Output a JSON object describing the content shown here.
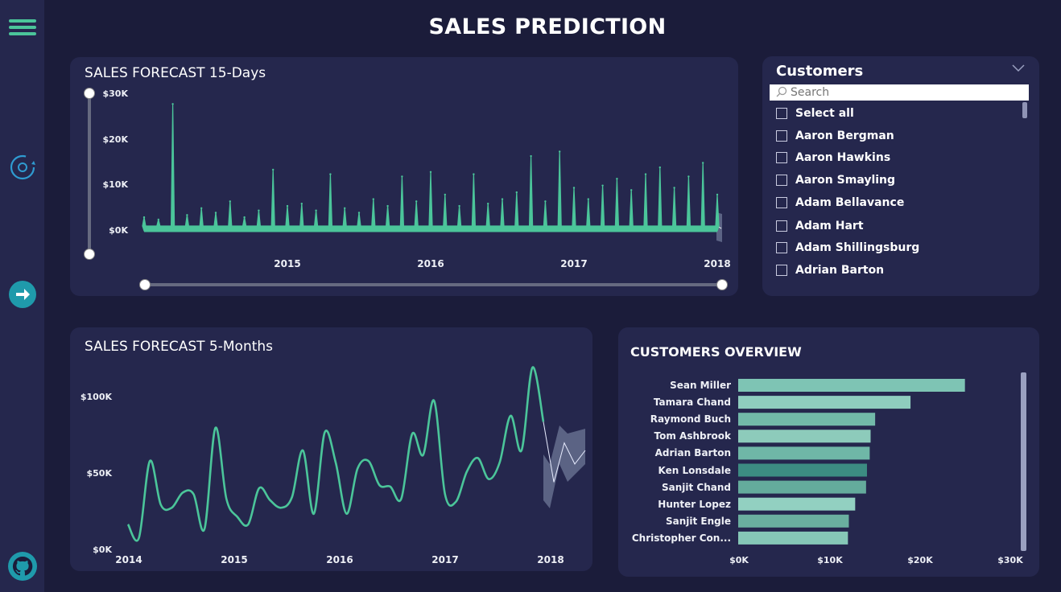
{
  "page_title": "SALES PREDICTION",
  "nav": {
    "icons": [
      "menu-icon",
      "refresh-cycle-icon",
      "arrow-right-icon",
      "github-icon"
    ]
  },
  "forecast_15days": {
    "title": "SALES FORECAST 15-Days",
    "y_ticks": [
      "$30K",
      "$20K",
      "$10K",
      "$0K"
    ],
    "x_ticks": [
      "2015",
      "2016",
      "2017",
      "2018"
    ]
  },
  "forecast_5months": {
    "title": "SALES FORECAST 5-Months",
    "y_ticks": [
      "$100K",
      "$50K",
      "$0K"
    ],
    "x_ticks": [
      "2014",
      "2015",
      "2016",
      "2017",
      "2018"
    ]
  },
  "customers_slicer": {
    "title": "Customers",
    "search_placeholder": "Search",
    "items": [
      "Select all",
      "Aaron Bergman",
      "Aaron Hawkins",
      "Aaron Smayling",
      "Adam Bellavance",
      "Adam Hart",
      "Adam Shillingsburg",
      "Adrian Barton"
    ]
  },
  "customers_overview": {
    "title": "CUSTOMERS OVERVIEW",
    "x_ticks": [
      "$0K",
      "$10K",
      "$20K",
      "$30K"
    ]
  },
  "colors": {
    "accent": "#4bc59a",
    "bar": "#7ec4b4",
    "bar_dark": "#3c8c82",
    "forecast_band": "#5b6384",
    "panel": "#25274d",
    "background": "#1b1c3a"
  },
  "chart_data": [
    {
      "type": "area",
      "title": "SALES FORECAST 15-Days",
      "xlabel": "",
      "ylabel": "",
      "ylim": [
        0,
        30000
      ],
      "x_ticks": [
        "2015",
        "2016",
        "2017",
        "2018"
      ],
      "series": [
        {
          "values": [
            3000,
            2500,
            28000,
            3500,
            5000,
            4000,
            6500,
            3000,
            4500,
            13500,
            5500,
            6000,
            4500,
            12500,
            5000,
            4000,
            7000,
            5500,
            12000,
            6500,
            13000,
            8000,
            5500,
            12500,
            6000,
            7000,
            8500,
            16500,
            6500,
            17500,
            9500,
            7000,
            10000,
            11500,
            9000,
            12500,
            14000,
            9500,
            12000,
            15000,
            8000
          ]
        }
      ]
    },
    {
      "type": "line",
      "title": "SALES FORECAST 5-Months",
      "xlabel": "",
      "ylabel": "",
      "ylim": [
        0,
        120000
      ],
      "x_ticks": [
        "2014",
        "2015",
        "2016",
        "2017",
        "2018"
      ],
      "series": [
        {
          "values": [
            15000,
            6000,
            57000,
            28000,
            26000,
            36000,
            35000,
            12000,
            79000,
            32000,
            20000,
            15000,
            39000,
            31000,
            26000,
            33000,
            64000,
            22000,
            76000,
            56000,
            22000,
            52000,
            57000,
            41000,
            40000,
            32000,
            75000,
            61000,
            97000,
            35000,
            30000,
            50000,
            59000,
            45000,
            56000,
            87000,
            64000,
            119000,
            83000
          ]
        },
        {
          "values": [
            83000,
            43000,
            69000,
            55000,
            64000
          ]
        }
      ]
    },
    {
      "type": "bar",
      "title": "CUSTOMERS OVERVIEW",
      "xlabel": "",
      "ylabel": "",
      "xlim": [
        0,
        30000
      ],
      "categories": [
        "Sean Miller",
        "Tamara Chand",
        "Raymond Buch",
        "Tom Ashbrook",
        "Adrian Barton",
        "Ken Lonsdale",
        "Sanjit Chand",
        "Hunter Lopez",
        "Sanjit Engle",
        "Christopher Con..."
      ],
      "values": [
        25000,
        19000,
        15100,
        14600,
        14500,
        14200,
        14100,
        12900,
        12200,
        12100
      ]
    }
  ]
}
